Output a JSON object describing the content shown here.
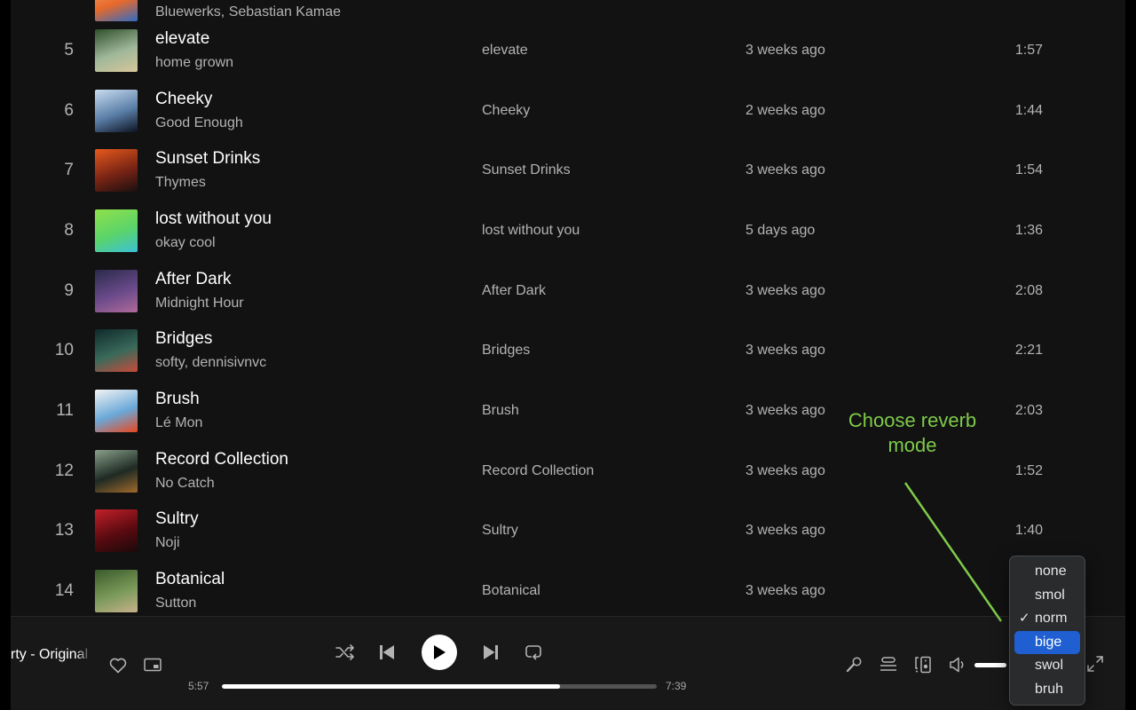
{
  "colors": {
    "background": "#121212",
    "player_background": "#181818",
    "text_primary": "#ffffff",
    "text_secondary": "#b3b3b3",
    "annotation": "#7ecb4a",
    "menu_highlight": "#1f5fd1"
  },
  "tracks": [
    {
      "number": "",
      "title": "",
      "artist": "Bluewerks, Sebastian Kamae",
      "album": "",
      "added": "",
      "duration": "",
      "art": [
        "#f6a878",
        "#e86a2a",
        "#2f6bc4"
      ]
    },
    {
      "number": "5",
      "title": "elevate",
      "artist": "home grown",
      "album": "elevate",
      "added": "3 weeks ago",
      "duration": "1:57",
      "art": [
        "#2f4f2a",
        "#9fb89a",
        "#d8c69a"
      ]
    },
    {
      "number": "6",
      "title": "Cheeky",
      "artist": "Good Enough",
      "album": "Cheeky",
      "added": "2 weeks ago",
      "duration": "1:44",
      "art": [
        "#c9dcf0",
        "#5b7fa8",
        "#0c1220"
      ]
    },
    {
      "number": "7",
      "title": "Sunset Drinks",
      "artist": "Thymes",
      "album": "Sunset Drinks",
      "added": "3 weeks ago",
      "duration": "1:54",
      "art": [
        "#e65a1e",
        "#7a2414",
        "#1a0f10"
      ]
    },
    {
      "number": "8",
      "title": "lost without you",
      "artist": "okay cool",
      "album": "lost without you",
      "added": "5 days ago",
      "duration": "1:36",
      "art": [
        "#8fe04a",
        "#5ad46a",
        "#3cc0d8"
      ]
    },
    {
      "number": "9",
      "title": "After Dark",
      "artist": "Midnight Hour",
      "album": "After Dark",
      "added": "3 weeks ago",
      "duration": "2:08",
      "art": [
        "#2a2a4a",
        "#6a4a8a",
        "#b06a9a"
      ]
    },
    {
      "number": "10",
      "title": "Bridges",
      "artist": "softy, dennisivnvc",
      "album": "Bridges",
      "added": "3 weeks ago",
      "duration": "2:21",
      "art": [
        "#0f2a2a",
        "#3a6a5a",
        "#c84a3a"
      ]
    },
    {
      "number": "11",
      "title": "Brush",
      "artist": "Lé Mon",
      "album": "Brush",
      "added": "3 weeks ago",
      "duration": "2:03",
      "art": [
        "#f4f4f4",
        "#6aa8d8",
        "#e8481e"
      ]
    },
    {
      "number": "12",
      "title": "Record Collection",
      "artist": "No Catch",
      "album": "Record Collection",
      "added": "3 weeks ago",
      "duration": "1:52",
      "art": [
        "#8aa08a",
        "#1e2a24",
        "#a06a2a"
      ]
    },
    {
      "number": "13",
      "title": "Sultry",
      "artist": "Noji",
      "album": "Sultry",
      "added": "3 weeks ago",
      "duration": "1:40",
      "art": [
        "#c4202a",
        "#5a0a10",
        "#1a0a0a"
      ]
    },
    {
      "number": "14",
      "title": "Botanical",
      "artist": "Sutton",
      "album": "Botanical",
      "added": "3 weeks ago",
      "duration": "",
      "art": [
        "#3a5a2a",
        "#7a9a5a",
        "#c8b08a"
      ]
    }
  ],
  "player": {
    "now_playing_title": "rty - Original",
    "elapsed": "5:57",
    "total": "7:39",
    "progress_fraction": 0.778,
    "volume_fraction": 1.0,
    "icons": {
      "like": "heart-icon",
      "pip": "picture-in-picture-icon",
      "shuffle": "shuffle-icon",
      "previous": "skip-previous-icon",
      "play": "play-icon",
      "next": "skip-next-icon",
      "repeat": "repeat-icon",
      "lyrics": "microphone-icon",
      "queue": "queue-icon",
      "devices": "connect-device-icon",
      "volume": "volume-icon",
      "fullscreen": "fullscreen-icon"
    }
  },
  "annotation": {
    "text": "Choose reverb mode"
  },
  "reverb_menu": {
    "options": [
      "none",
      "smol",
      "norm",
      "bige",
      "swol",
      "bruh"
    ],
    "checked": "norm",
    "highlighted": "bige",
    "check_glyph": "✓"
  }
}
